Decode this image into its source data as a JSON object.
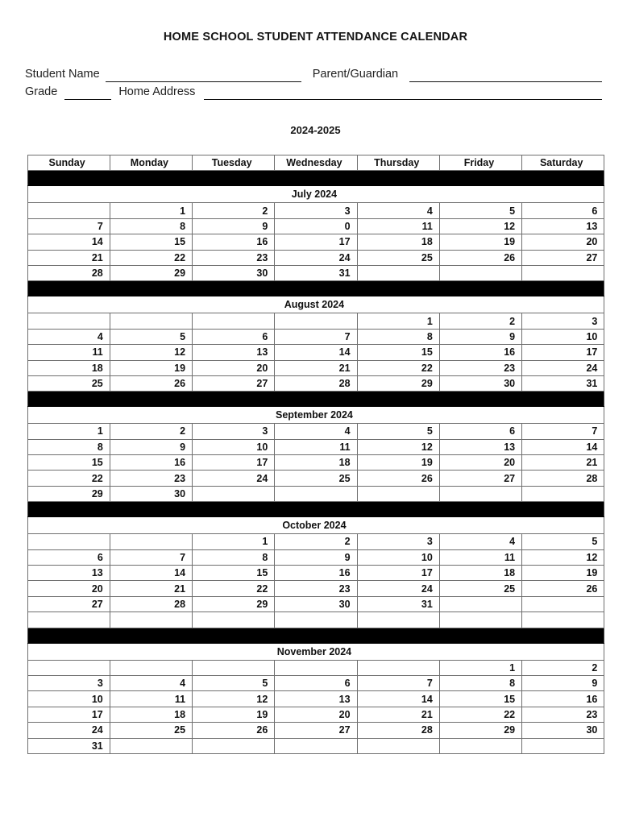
{
  "document": {
    "title": "HOME SCHOOL STUDENT ATTENDANCE CALENDAR",
    "school_year": "2024-2025"
  },
  "form": {
    "student_name_label": "Student Name",
    "student_name_value": "",
    "parent_guardian_label": "Parent/Guardian",
    "parent_guardian_value": "",
    "grade_label": "Grade",
    "grade_value": "",
    "home_address_label": "Home Address",
    "home_address_value": ""
  },
  "calendar": {
    "weekday_headers": [
      "Sunday",
      "Monday",
      "Tuesday",
      "Wednesday",
      "Thursday",
      "Friday",
      "Saturday"
    ],
    "months": [
      {
        "name": "July 2024",
        "weeks": [
          [
            "",
            "1",
            "2",
            "3",
            "4",
            "5",
            "6"
          ],
          [
            "7",
            "8",
            "9",
            "0",
            "11",
            "12",
            "13"
          ],
          [
            "14",
            "15",
            "16",
            "17",
            "18",
            "19",
            "20"
          ],
          [
            "21",
            "22",
            "23",
            "24",
            "25",
            "26",
            "27"
          ],
          [
            "28",
            "29",
            "30",
            "31",
            "",
            "",
            ""
          ]
        ]
      },
      {
        "name": "August 2024",
        "weeks": [
          [
            "",
            "",
            "",
            "",
            "1",
            "2",
            "3"
          ],
          [
            "4",
            "5",
            "6",
            "7",
            "8",
            "9",
            "10"
          ],
          [
            "11",
            "12",
            "13",
            "14",
            "15",
            "16",
            "17"
          ],
          [
            "18",
            "19",
            "20",
            "21",
            "22",
            "23",
            "24"
          ],
          [
            "25",
            "26",
            "27",
            "28",
            "29",
            "30",
            "31"
          ]
        ]
      },
      {
        "name": "September 2024",
        "weeks": [
          [
            "1",
            "2",
            "3",
            "4",
            "5",
            "6",
            "7"
          ],
          [
            "8",
            "9",
            "10",
            "11",
            "12",
            "13",
            "14"
          ],
          [
            "15",
            "16",
            "17",
            "18",
            "19",
            "20",
            "21"
          ],
          [
            "22",
            "23",
            "24",
            "25",
            "26",
            "27",
            "28"
          ],
          [
            "29",
            "30",
            "",
            "",
            "",
            "",
            ""
          ]
        ]
      },
      {
        "name": "October 2024",
        "weeks": [
          [
            "",
            "",
            "1",
            "2",
            "3",
            "4",
            "5"
          ],
          [
            "6",
            "7",
            "8",
            "9",
            "10",
            "11",
            "12"
          ],
          [
            "13",
            "14",
            "15",
            "16",
            "17",
            "18",
            "19"
          ],
          [
            "20",
            "21",
            "22",
            "23",
            "24",
            "25",
            "26"
          ],
          [
            "27",
            "28",
            "29",
            "30",
            "31",
            "",
            ""
          ],
          [
            "",
            "",
            "",
            "",
            "",
            "",
            ""
          ]
        ]
      },
      {
        "name": "November 2024",
        "weeks": [
          [
            "",
            "",
            "",
            "",
            "",
            "1",
            "2"
          ],
          [
            "3",
            "4",
            "5",
            "6",
            "7",
            "8",
            "9"
          ],
          [
            "10",
            "11",
            "12",
            "13",
            "14",
            "15",
            "16"
          ],
          [
            "17",
            "18",
            "19",
            "20",
            "21",
            "22",
            "23"
          ],
          [
            "24",
            "25",
            "26",
            "27",
            "28",
            "29",
            "30"
          ],
          [
            "31",
            "",
            "",
            "",
            "",
            "",
            ""
          ]
        ]
      }
    ]
  },
  "colors": {
    "separator_bar": "#000000",
    "grid_line": "#6f6f6f",
    "outer_border": "#4a4a4a",
    "text": "#111111"
  }
}
